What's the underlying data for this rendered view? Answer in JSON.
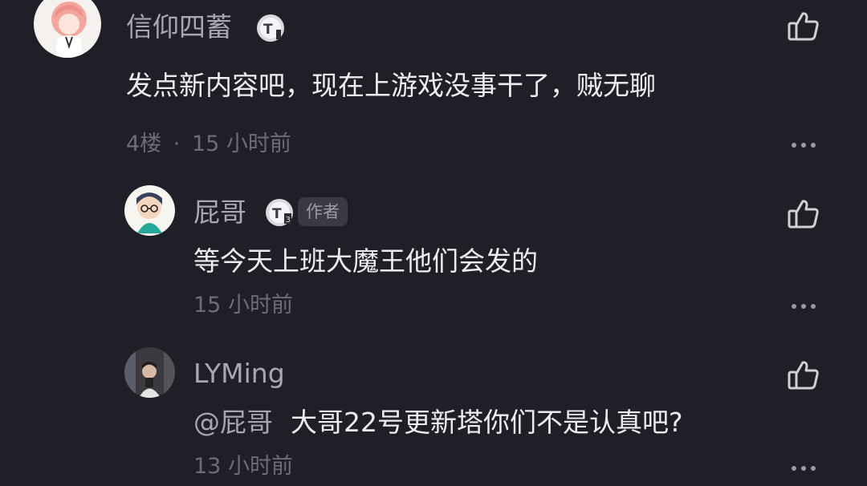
{
  "comment": {
    "user_name": "信仰四蓄",
    "level_icon": "level-badge-icon",
    "text": "发点新内容吧，现在上游戏没事干了，贼无聊",
    "floor": "4楼",
    "separator": "·",
    "time": "15 小时前",
    "like_icon": "thumbs-up-icon",
    "more_icon": "more-icon"
  },
  "replies": [
    {
      "user_name": "屁哥",
      "level_icon": "level-3-badge-icon",
      "author_tag": "作者",
      "text": "等今天上班大魔王他们会发的",
      "time": "15 小时前"
    },
    {
      "user_name": "LYMing",
      "mention": "@屁哥",
      "text": "大哥22号更新塔你们不是认真吧?",
      "time": "13 小时前"
    }
  ],
  "colors": {
    "background": "#1f1f27",
    "name": "#a8a8b3",
    "content": "#ececf1",
    "meta": "#6c6c77",
    "author_tag_bg": "#3a3a44"
  }
}
